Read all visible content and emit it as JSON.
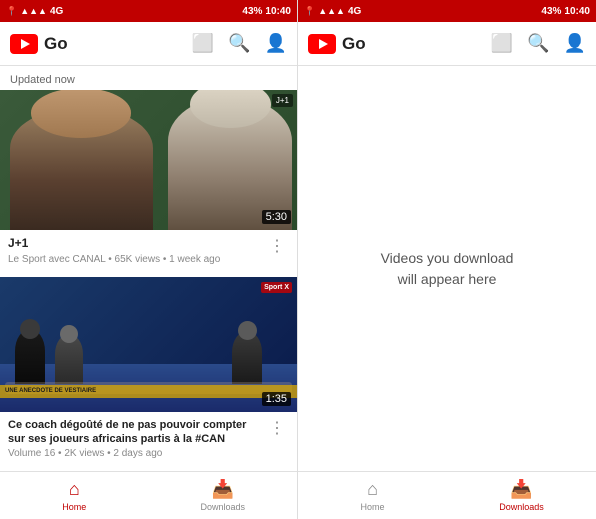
{
  "statusBar": {
    "leftIcon": "▲",
    "signals": "◀ ◀ ◀",
    "network": "4G",
    "battery": "43%",
    "time": "10:40"
  },
  "appBar": {
    "title": "Go",
    "castIconLabel": "cast-icon",
    "searchIconLabel": "search-icon",
    "accountIconLabel": "account-icon"
  },
  "screen1": {
    "updatedLabel": "Updated now",
    "videos": [
      {
        "title": "J+1",
        "meta": "Le Sport avec CANAL • 65K views • 1 week ago",
        "duration": "5:30"
      },
      {
        "title": "Ce coach dégoûté de ne pas pouvoir compter sur ses joueurs africains partis à la #CAN",
        "meta": "Volume 16 • 2K views • 2 days ago",
        "duration": "1:35"
      }
    ],
    "nav": {
      "home": "Home",
      "downloads": "Downloads"
    }
  },
  "screen2": {
    "emptyText": "Videos you download\nwill appear here",
    "nav": {
      "home": "Home",
      "downloads": "Downloads"
    }
  }
}
